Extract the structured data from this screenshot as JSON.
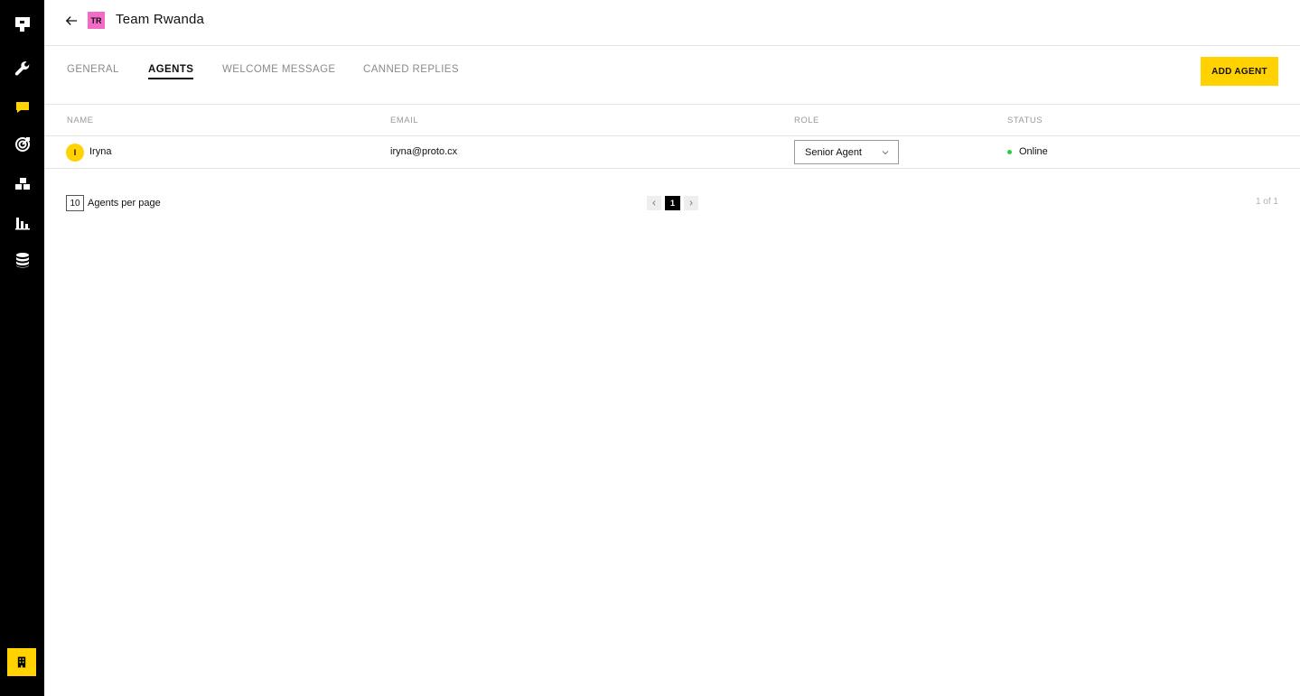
{
  "header": {
    "team_initials": "TR",
    "team_badge_color": "#f26bc6",
    "title": "Team Rwanda"
  },
  "sidebar": {
    "items": [
      {
        "icon": "logo-icon"
      },
      {
        "icon": "wrench-icon"
      },
      {
        "icon": "chat-icon",
        "active": true
      },
      {
        "icon": "target-icon"
      },
      {
        "icon": "blocks-icon"
      },
      {
        "icon": "bar-chart-icon"
      },
      {
        "icon": "database-icon"
      }
    ],
    "bottom_icon": "building-icon",
    "accent": "#ffd200"
  },
  "tabs": [
    {
      "label": "GENERAL",
      "active": false
    },
    {
      "label": "AGENTS",
      "active": true
    },
    {
      "label": "WELCOME MESSAGE",
      "active": false
    },
    {
      "label": "CANNED REPLIES",
      "active": false
    }
  ],
  "actions": {
    "add_agent_label": "ADD AGENT"
  },
  "table": {
    "columns": [
      "NAME",
      "EMAIL",
      "ROLE",
      "STATUS"
    ],
    "rows": [
      {
        "initial": "I",
        "name": "Iryna",
        "email": "iryna@proto.cx",
        "role": "Senior Agent",
        "status": "Online",
        "status_color": "#2ecc40"
      }
    ]
  },
  "pagination": {
    "per_page": "10",
    "per_page_label": "Agents per page",
    "current_page": "1",
    "summary": "1 of 1"
  }
}
